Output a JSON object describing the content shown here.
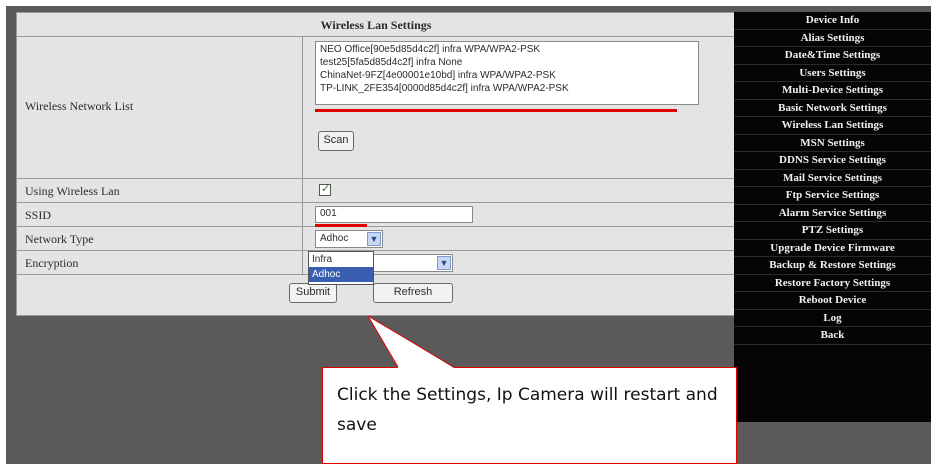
{
  "panel": {
    "title": "Wireless Lan Settings",
    "network_list_label": "Wireless Network List",
    "networks": [
      "NEO Office[90e5d85d4c2f] infra WPA/WPA2-PSK",
      "test25[5fa5d85d4c2f] infra None",
      "ChinaNet-9FZ[4e00001e10bd] infra WPA/WPA2-PSK",
      "TP-LINK_2FE354[0000d85d4c2f] infra WPA/WPA2-PSK"
    ],
    "scan_label": "Scan",
    "using_label": "Using Wireless Lan",
    "using_checked": true,
    "ssid_label": "SSID",
    "ssid_value": "001",
    "network_type_label": "Network Type",
    "network_type_value": "Adhoc",
    "network_type_options": [
      "Infra",
      "Adhoc"
    ],
    "encryption_label": "Encryption",
    "submit_label": "Submit",
    "refresh_label": "Refresh",
    "colors": {
      "highlight_red": "#e00000",
      "option_selected": "#3a5fb0",
      "menu_bg": "#050505"
    }
  },
  "menu": {
    "items": [
      "Device Info",
      "Alias Settings",
      "Date&Time Settings",
      "Users Settings",
      "Multi-Device Settings",
      "Basic Network Settings",
      "Wireless Lan Settings",
      "MSN Settings",
      "DDNS Service Settings",
      "Mail Service Settings",
      "Ftp Service Settings",
      "Alarm Service Settings",
      "PTZ Settings",
      "Upgrade Device Firmware",
      "Backup & Restore Settings",
      "Restore Factory Settings",
      "Reboot Device",
      "Log",
      "Back"
    ]
  },
  "callout": {
    "text": "Click the Settings, Ip Camera will restart and save"
  },
  "icons": {
    "checkbox": "check-icon",
    "select_arrow": "chevron-down-icon"
  }
}
